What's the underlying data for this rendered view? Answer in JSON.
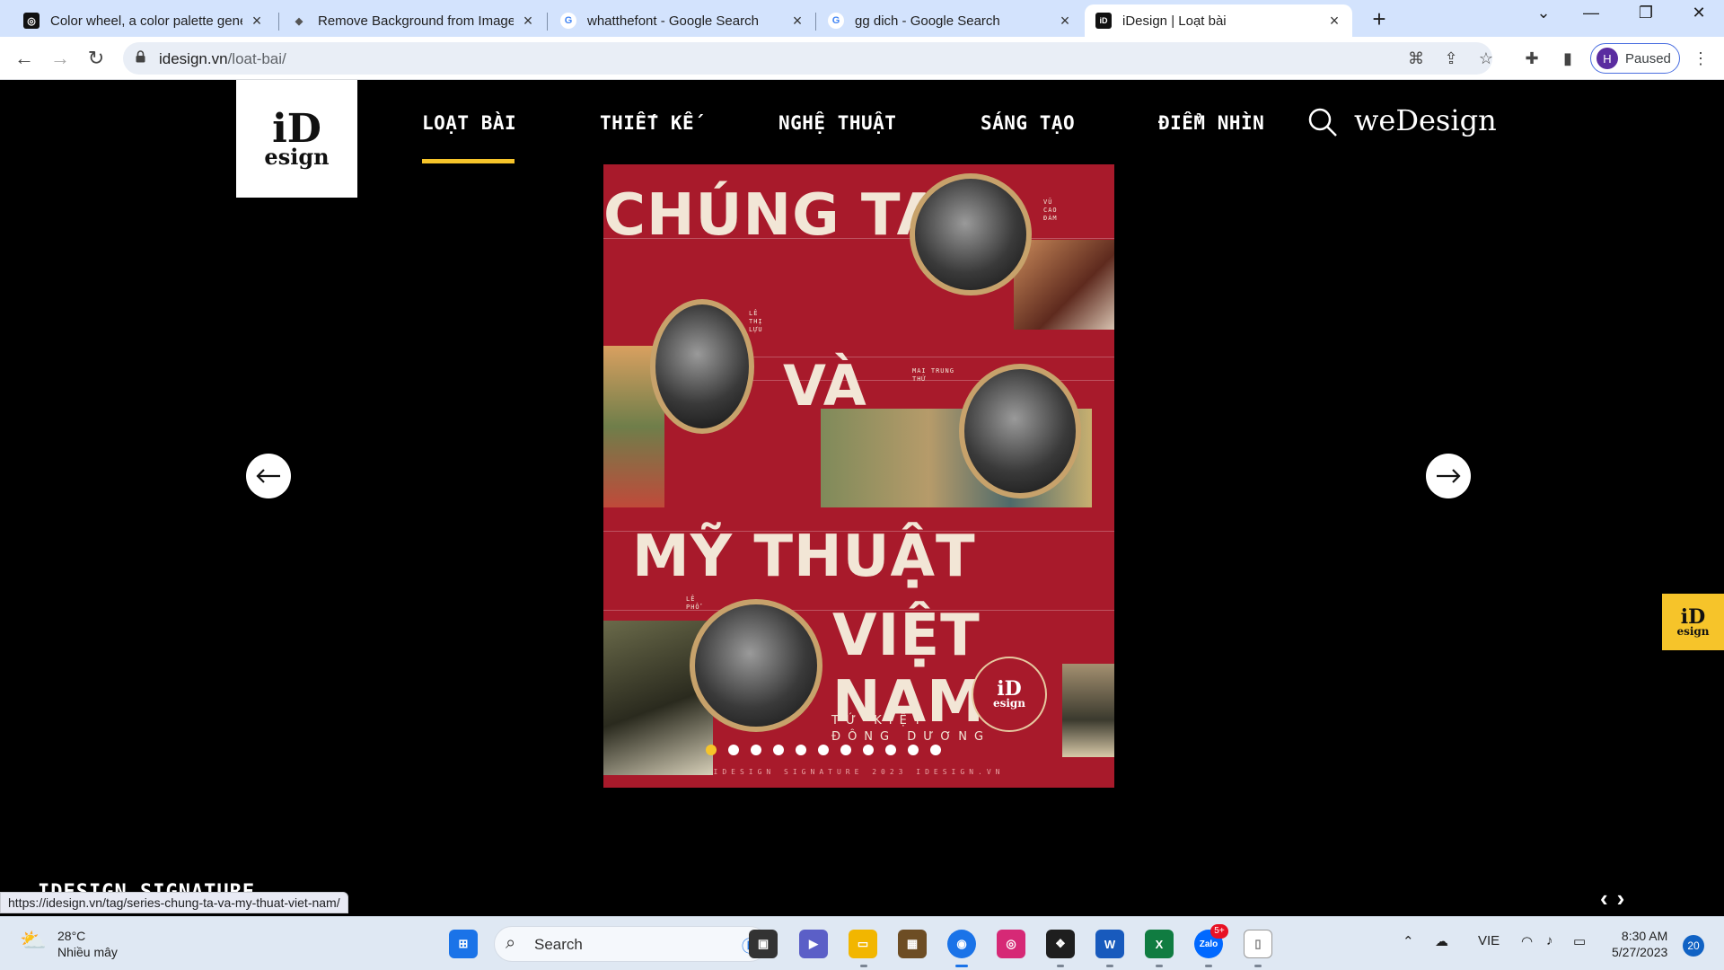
{
  "browser": {
    "tabs": [
      {
        "title": "Color wheel, a color palette gene",
        "close": "×"
      },
      {
        "title": "Remove Background from Image",
        "close": "×"
      },
      {
        "title": "whatthefont - Google Search",
        "close": "×"
      },
      {
        "title": "gg dich - Google Search",
        "close": "×"
      },
      {
        "title": "iDesign | Loạt bài",
        "close": "×"
      }
    ],
    "new_tab": "+",
    "url_host": "idesign.vn",
    "url_path": "/loat-bai/",
    "profile_initial": "H",
    "profile_status": "Paused"
  },
  "site": {
    "logo_top": "iD",
    "logo_bottom": "esign",
    "nav": [
      "LOẠT BÀI",
      "THIẾT KẾ",
      "NGHỆ THUẬT",
      "SÁNG TẠO",
      "ĐIỂM NHÌN"
    ],
    "active_nav_index": 0,
    "wedesign": "weDesign",
    "accent_color": "#f6c42a",
    "poster": {
      "line1": "CHÚNG TA",
      "line2": "VÀ",
      "line3": "MỸ THUẬT",
      "line4": "VIỆT NAM",
      "subtitle1": "TỨ KIỆT",
      "subtitle2": "ĐÔNG DƯƠNG",
      "label_a": "VŨ CAO ĐÀM",
      "label_b": "LÊ THỊ LỰU",
      "label_c": "MAI TRUNG THỨ",
      "label_d": "LÊ PHỔ",
      "footer": "IDESIGN SIGNATURE    2023    IDESIGN.VN",
      "seal_top": "iD",
      "seal_bottom": "esign",
      "background_color": "#a81a2b"
    },
    "carousel_dot_count": 11,
    "carousel_active_dot": 0,
    "badge_top": "iD",
    "badge_bottom": "esign",
    "section_title": "IDESIGN SIGNATURE",
    "status_url": "https://idesign.vn/tag/series-chung-ta-va-my-thuat-viet-nam/"
  },
  "taskbar": {
    "weather_temp": "28°C",
    "weather_desc": "Nhiều mây",
    "search_label": "Search",
    "language": "VIE",
    "time": "8:30 AM",
    "date": "5/27/2023",
    "notification_count": "20",
    "zalo_badge": "5+"
  }
}
